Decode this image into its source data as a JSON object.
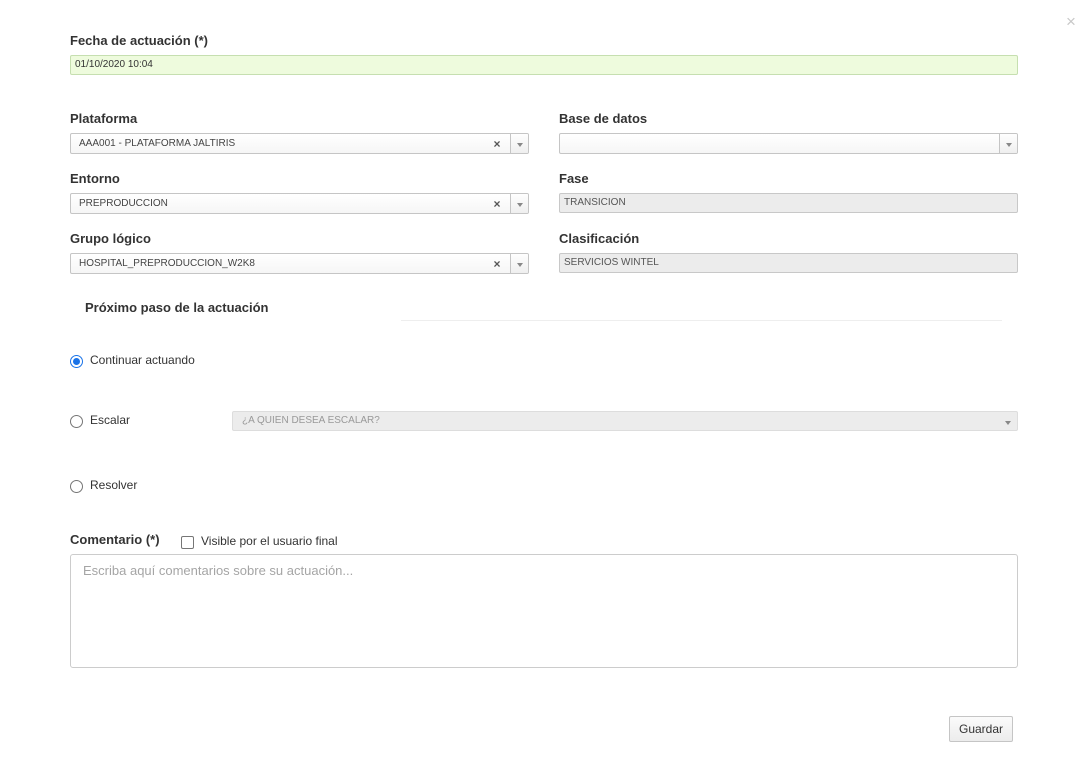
{
  "dialog": {
    "close_symbol": "×"
  },
  "fecha": {
    "label": "Fecha de actuación (*)",
    "value": "01/10/2020 10:04"
  },
  "plataforma": {
    "label": "Plataforma",
    "value": "AAA001 - PLATAFORMA JALTIRIS"
  },
  "base_datos": {
    "label": "Base de datos",
    "value": ""
  },
  "entorno": {
    "label": "Entorno",
    "value": "PREPRODUCCION"
  },
  "fase": {
    "label": "Fase",
    "value": "TRANSICION"
  },
  "grupo_logico": {
    "label": "Grupo lógico",
    "value": "HOSPITAL_PREPRODUCCION_W2K8"
  },
  "clasificacion": {
    "label": "Clasificación",
    "value": "SERVICIOS WINTEL"
  },
  "proximo_paso": {
    "title": "Próximo paso de la actuación",
    "options": [
      {
        "label": "Continuar actuando",
        "checked": true
      },
      {
        "label": "Escalar",
        "checked": false
      },
      {
        "label": "Resolver",
        "checked": false
      }
    ],
    "escalar_placeholder": "¿A QUIEN DESEA ESCALAR?"
  },
  "comentario": {
    "label": "Comentario (*)",
    "visible_label": "Visible por el usuario final",
    "visible_checked": false,
    "placeholder": "Escriba aquí comentarios sobre su actuación..."
  },
  "actions": {
    "save_label": "Guardar"
  },
  "icons": {
    "clear": "×",
    "dropdown": "chevron-down-icon",
    "close": "close-icon"
  }
}
